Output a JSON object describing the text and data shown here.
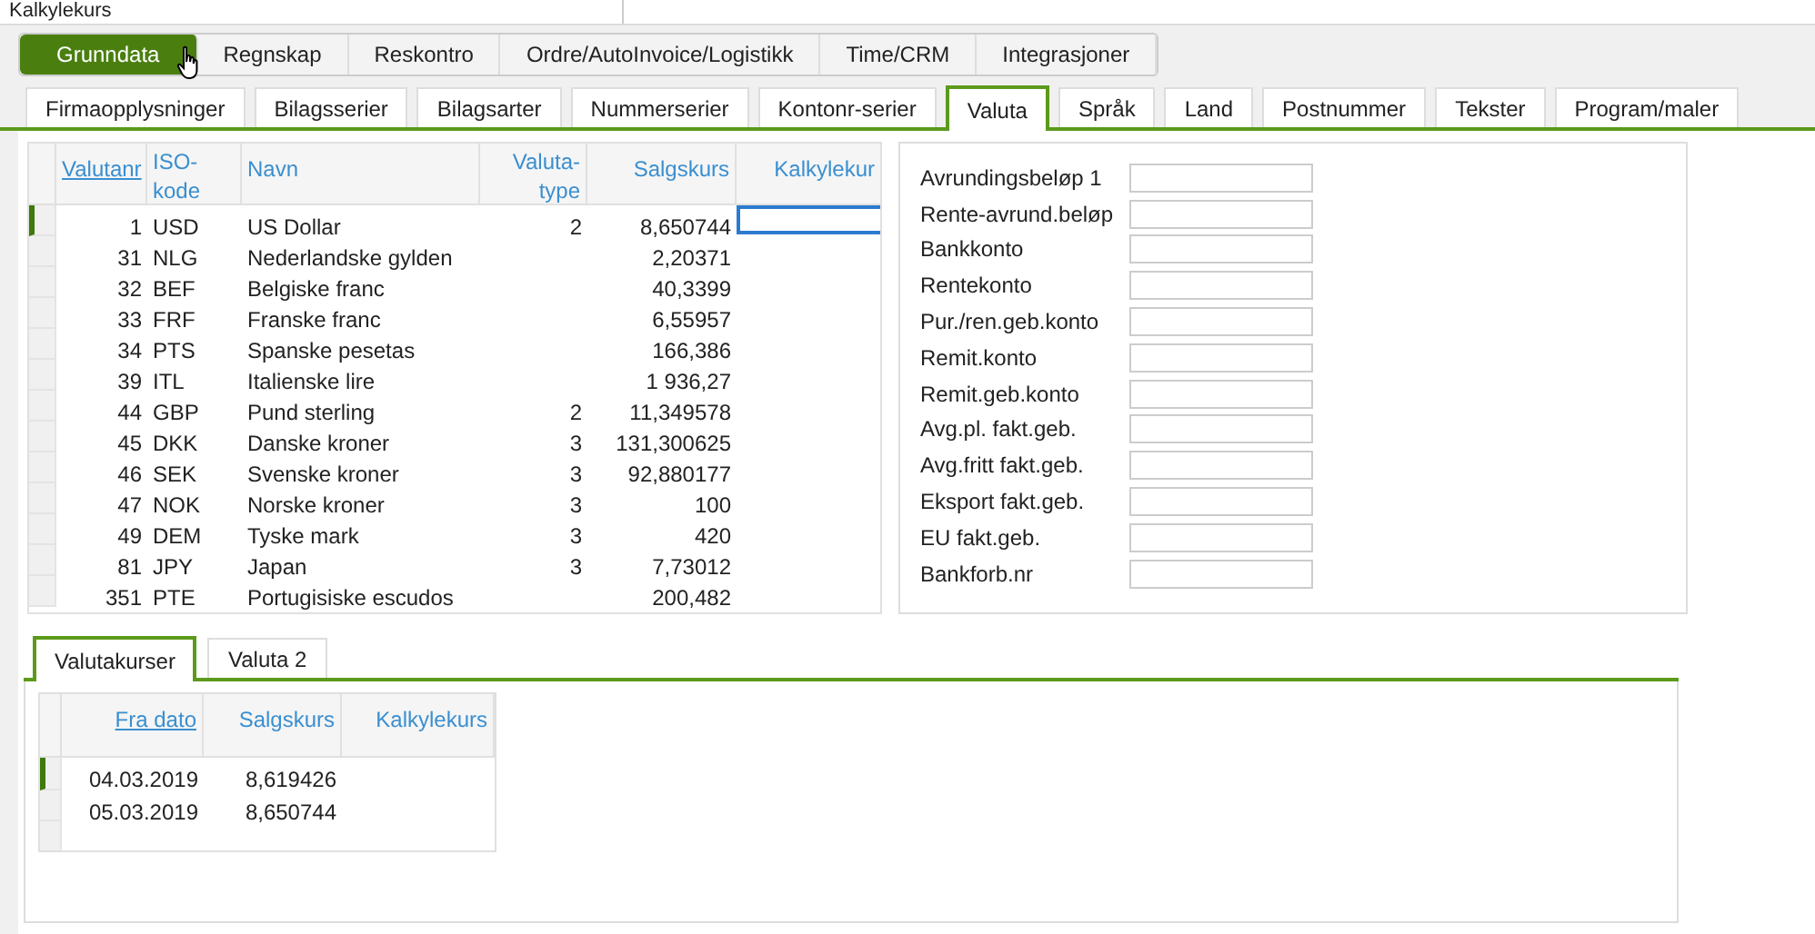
{
  "top_strip": {
    "text": "Kalkylekurs"
  },
  "main_tabs": [
    {
      "label": "Grunndata",
      "selected": true
    },
    {
      "label": "Regnskap",
      "selected": false
    },
    {
      "label": "Reskontro",
      "selected": false
    },
    {
      "label": "Ordre/AutoInvoice/Logistikk",
      "selected": false
    },
    {
      "label": "Time/CRM",
      "selected": false
    },
    {
      "label": "Integrasjoner",
      "selected": false
    }
  ],
  "sub_tabs": [
    {
      "label": "Firmaopplysninger",
      "selected": false
    },
    {
      "label": "Bilagsserier",
      "selected": false
    },
    {
      "label": "Bilagsarter",
      "selected": false
    },
    {
      "label": "Nummerserier",
      "selected": false
    },
    {
      "label": "Kontonr-serier",
      "selected": false
    },
    {
      "label": "Valuta",
      "selected": true
    },
    {
      "label": "Språk",
      "selected": false
    },
    {
      "label": "Land",
      "selected": false
    },
    {
      "label": "Postnummer",
      "selected": false
    },
    {
      "label": "Tekster",
      "selected": false
    },
    {
      "label": "Program/maler",
      "selected": false
    }
  ],
  "currency_table": {
    "columns": [
      {
        "label": "Valutanr",
        "sorted": true
      },
      {
        "label": "ISO-kode",
        "sorted": false
      },
      {
        "label": "Navn",
        "sorted": false
      },
      {
        "label": "Valuta-type",
        "sorted": false
      },
      {
        "label": "Salgskurs",
        "sorted": false
      },
      {
        "label": "Kalkylekur",
        "sorted": false
      }
    ],
    "rows": [
      {
        "selected": true,
        "cells": [
          "1",
          "USD",
          "US Dollar",
          "2",
          "8,650744"
        ]
      },
      {
        "selected": false,
        "cells": [
          "31",
          "NLG",
          "Nederlandske gylden",
          "",
          "2,20371"
        ]
      },
      {
        "selected": false,
        "cells": [
          "32",
          "BEF",
          "Belgiske franc",
          "",
          "40,3399"
        ]
      },
      {
        "selected": false,
        "cells": [
          "33",
          "FRF",
          "Franske franc",
          "",
          "6,55957"
        ]
      },
      {
        "selected": false,
        "cells": [
          "34",
          "PTS",
          "Spanske pesetas",
          "",
          "166,386"
        ]
      },
      {
        "selected": false,
        "cells": [
          "39",
          "ITL",
          "Italienske lire",
          "",
          "1 936,27"
        ]
      },
      {
        "selected": false,
        "cells": [
          "44",
          "GBP",
          "Pund sterling",
          "2",
          "11,349578"
        ]
      },
      {
        "selected": false,
        "cells": [
          "45",
          "DKK",
          "Danske kroner",
          "3",
          "131,300625"
        ]
      },
      {
        "selected": false,
        "cells": [
          "46",
          "SEK",
          "Svenske kroner",
          "3",
          "92,880177"
        ]
      },
      {
        "selected": false,
        "cells": [
          "47",
          "NOK",
          "Norske kroner",
          "3",
          "100"
        ]
      },
      {
        "selected": false,
        "cells": [
          "49",
          "DEM",
          "Tyske mark",
          "3",
          "420"
        ]
      },
      {
        "selected": false,
        "cells": [
          "81",
          "JPY",
          "Japan",
          "3",
          "7,73012"
        ]
      },
      {
        "selected": false,
        "cells": [
          "351",
          "PTE",
          "Portugisiske escudos",
          "",
          "200,482"
        ]
      }
    ]
  },
  "form_fields": [
    {
      "label": "Avrundingsbeløp 1"
    },
    {
      "label": "Rente-avrund.beløp"
    },
    {
      "label": "Bankkonto"
    },
    {
      "label": "Rentekonto"
    },
    {
      "label": "Pur./ren.geb.konto"
    },
    {
      "label": "Remit.konto"
    },
    {
      "label": "Remit.geb.konto"
    },
    {
      "label": "Avg.pl. fakt.geb."
    },
    {
      "label": "Avg.fritt fakt.geb."
    },
    {
      "label": "Eksport fakt.geb."
    },
    {
      "label": "EU fakt.geb."
    },
    {
      "label": "Bankforb.nr"
    }
  ],
  "lower_tabs": [
    {
      "label": "Valutakurser",
      "selected": true
    },
    {
      "label": "Valuta 2",
      "selected": false
    }
  ],
  "rate_table": {
    "columns": [
      {
        "label": "Fra dato",
        "sorted": true
      },
      {
        "label": "Salgskurs",
        "sorted": false
      },
      {
        "label": "Kalkylekurs",
        "sorted": false
      }
    ],
    "rows": [
      {
        "selected": true,
        "cells": [
          "04.03.2019",
          "8,619426"
        ]
      },
      {
        "selected": false,
        "cells": [
          "05.03.2019",
          "8,650744"
        ]
      }
    ]
  }
}
